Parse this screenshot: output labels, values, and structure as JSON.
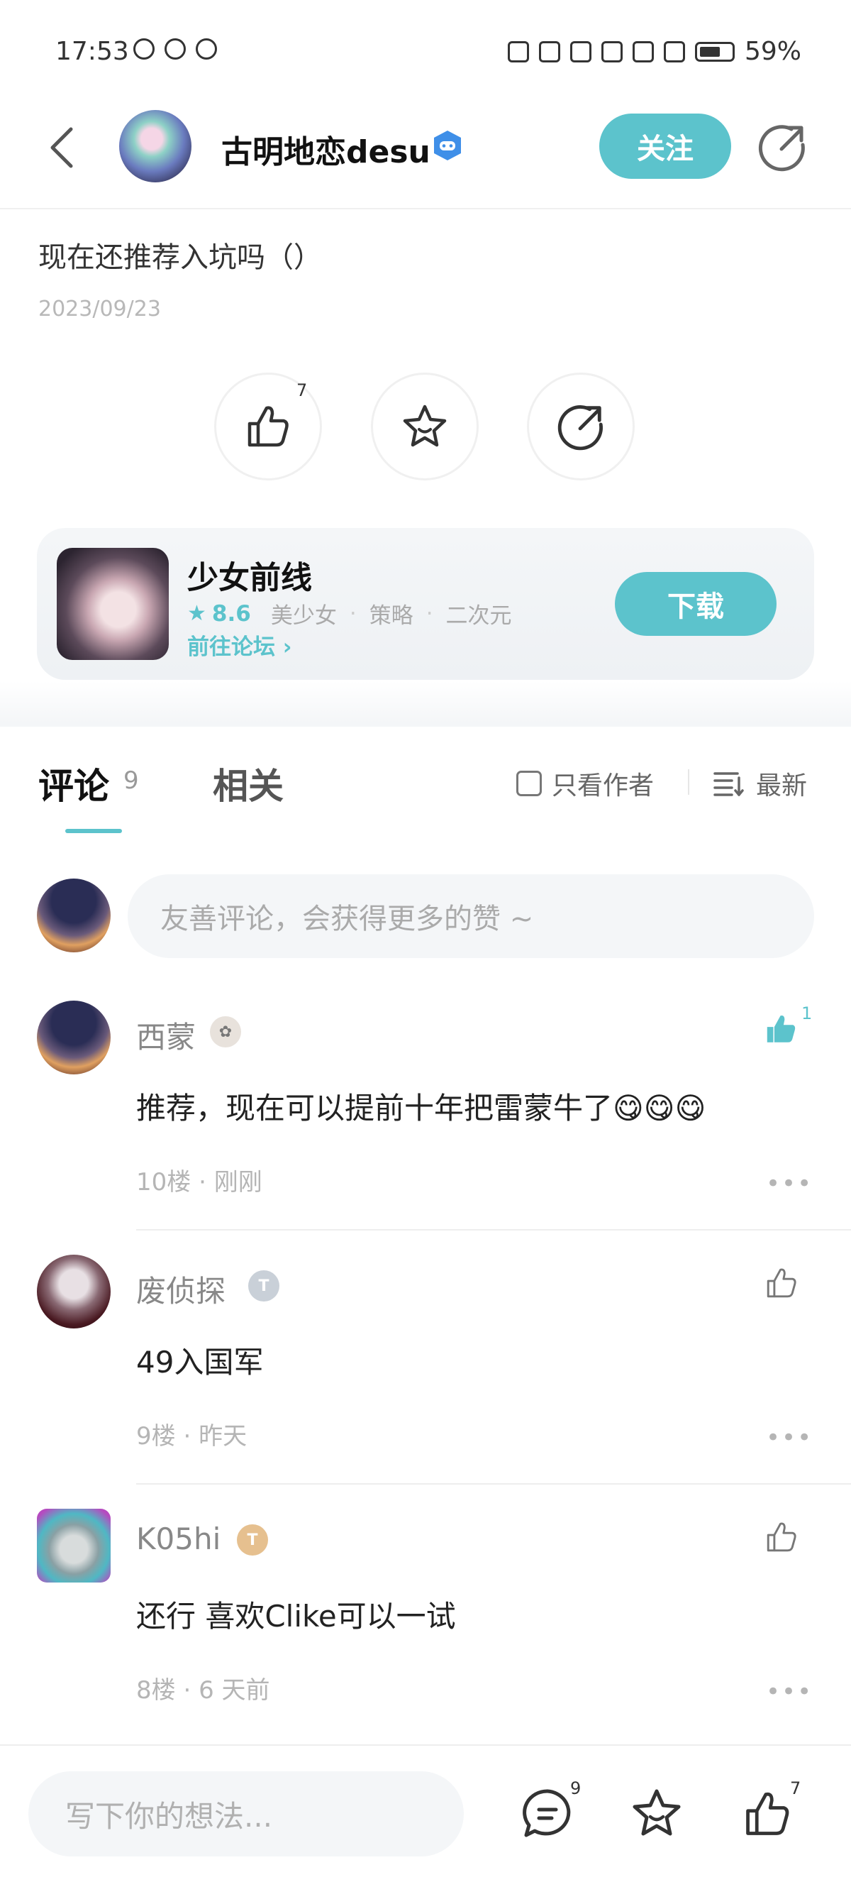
{
  "status_bar": {
    "time": "17:53",
    "battery": "59%"
  },
  "header": {
    "author_name": "古明地恋desu",
    "follow_label": "关注"
  },
  "post": {
    "title": "现在还推荐入坑吗（）",
    "date": "2023/09/23",
    "like_count": "7"
  },
  "game_card": {
    "name": "少女前线",
    "score": "8.6",
    "tags": [
      "美少女",
      "策略",
      "二次元"
    ],
    "forum_link": "前往论坛",
    "download_label": "下载"
  },
  "tabs": {
    "comments_label": "评论",
    "comments_count": "9",
    "related_label": "相关",
    "author_only_label": "只看作者",
    "sort_label": "最新"
  },
  "comment_input": {
    "placeholder": "友善评论，会获得更多的赞 ~"
  },
  "comments": [
    {
      "name": "西蒙",
      "text": "推荐，现在可以提前十年把雷蒙牛了😋😋😋",
      "floor": "10楼",
      "time": "刚刚",
      "likes": "1",
      "liked": true
    },
    {
      "name": "废侦探",
      "text": "49入国军",
      "floor": "9楼",
      "time": "昨天",
      "likes": "",
      "liked": false
    },
    {
      "name": "K05hi",
      "text": "还行 喜欢Clike可以一试",
      "floor": "8楼",
      "time": "6 天前",
      "likes": "",
      "liked": false
    }
  ],
  "meta_separator": " · ",
  "bottom_bar": {
    "placeholder": "写下你的想法...",
    "comment_count": "9",
    "like_count": "7"
  },
  "colors": {
    "accent": "#5cc3cc",
    "text_primary": "#222222",
    "text_muted": "#b5b5b5"
  }
}
